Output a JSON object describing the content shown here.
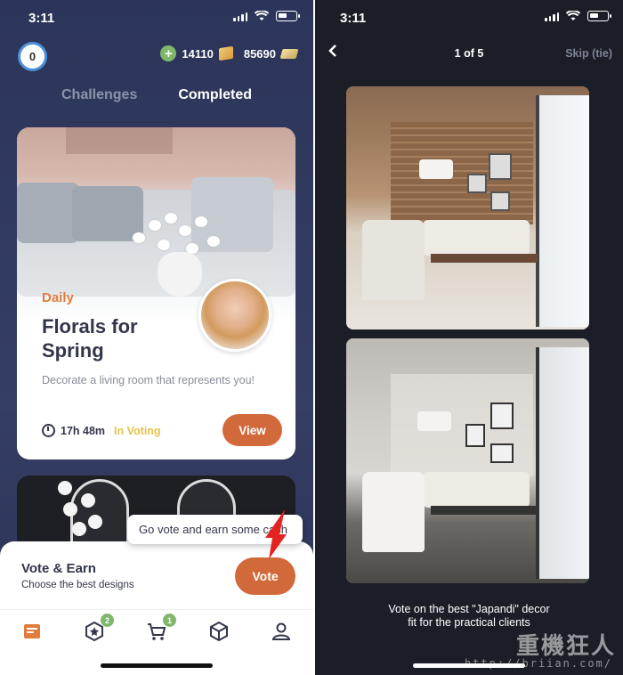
{
  "left": {
    "status_time": "3:11",
    "level": "0",
    "coins": "14110",
    "gold": "85690",
    "tabs": [
      "Challenges",
      "Completed"
    ],
    "card": {
      "category": "Daily",
      "title": "Florals for Spring",
      "description": "Decorate a living room that represents you!",
      "timer": "17h 48m",
      "status": "In Voting",
      "view_label": "View"
    },
    "tooltip": "Go vote and earn some cash",
    "vote_panel": {
      "title": "Vote & Earn",
      "subtitle": "Choose the best designs",
      "button": "Vote"
    },
    "tabbar": {
      "badge_2": "2",
      "badge_3": "1"
    }
  },
  "right": {
    "status_time": "3:11",
    "counter": "1 of 5",
    "skip": "Skip (tie)",
    "caption_line1": "Vote on the best \"Japandi\" decor",
    "caption_line2": "fit for the practical clients"
  },
  "watermark": {
    "brand": "重機狂人",
    "url": "http://briian.com/"
  },
  "colors": {
    "accent_orange": "#d2693a",
    "in_voting_yellow": "#e6c24b",
    "badge_green": "#7fb86a",
    "left_bg": "#2c3559",
    "right_bg": "#1b1e26"
  }
}
